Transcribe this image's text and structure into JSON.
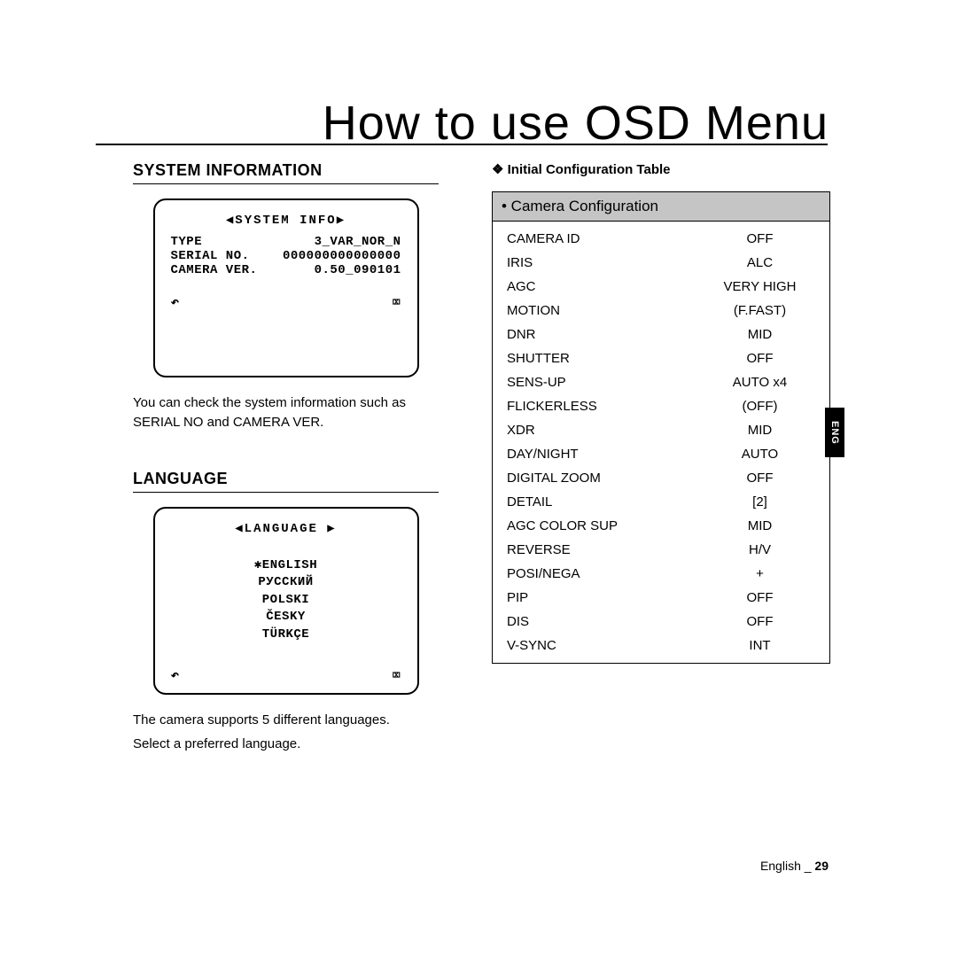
{
  "chapter_title": "How to use OSD Menu",
  "left": {
    "sysinfo_heading": "SYSTEM INFORMATION",
    "osd_sysinfo": {
      "title": "◀SYSTEM INFO▶",
      "type_label": "TYPE",
      "type_value": "3_VAR_NOR_N",
      "serial_label": "SERIAL NO.",
      "serial_value": "000000000000000",
      "ver_label": "CAMERA VER.",
      "ver_value": "0.50_090101",
      "back_icon": "↶",
      "exit_icon": "⌧"
    },
    "sysinfo_text": "You can check the system information such as SERIAL NO and CAMERA VER.",
    "lang_heading": "LANGUAGE",
    "osd_lang": {
      "title": "◀LANGUAGE ▶",
      "items": [
        "✱ENGLISH",
        "РУССКИЙ",
        "POLSKI",
        "ČESKY",
        "TÜRKÇE"
      ],
      "back_icon": "↶",
      "exit_icon": "⌧"
    },
    "lang_text_1": "The camera supports 5 different languages.",
    "lang_text_2": "Select a preferred language."
  },
  "right": {
    "initial_heading": "❖ Initial Configuration Table",
    "table_header": "• Camera Configuration",
    "rows": [
      {
        "k": "CAMERA ID",
        "v": "OFF"
      },
      {
        "k": "IRIS",
        "v": "ALC"
      },
      {
        "k": "AGC",
        "v": "VERY HIGH"
      },
      {
        "k": "MOTION",
        "v": "(F.FAST)"
      },
      {
        "k": "DNR",
        "v": "MID"
      },
      {
        "k": "SHUTTER",
        "v": "OFF"
      },
      {
        "k": "SENS-UP",
        "v": "AUTO x4"
      },
      {
        "k": "FLICKERLESS",
        "v": "(OFF)"
      },
      {
        "k": "XDR",
        "v": "MID"
      },
      {
        "k": "DAY/NIGHT",
        "v": "AUTO"
      },
      {
        "k": "DIGITAL ZOOM",
        "v": "OFF"
      },
      {
        "k": "DETAIL",
        "v": "[2]"
      },
      {
        "k": "AGC COLOR SUP",
        "v": "MID"
      },
      {
        "k": "REVERSE",
        "v": "H/V"
      },
      {
        "k": "POSI/NEGA",
        "v": "+"
      },
      {
        "k": "PIP",
        "v": "OFF"
      },
      {
        "k": "DIS",
        "v": "OFF"
      },
      {
        "k": "V-SYNC",
        "v": "INT"
      }
    ]
  },
  "side_tab": "ENG",
  "footer_lang": "English _",
  "footer_page": "29"
}
